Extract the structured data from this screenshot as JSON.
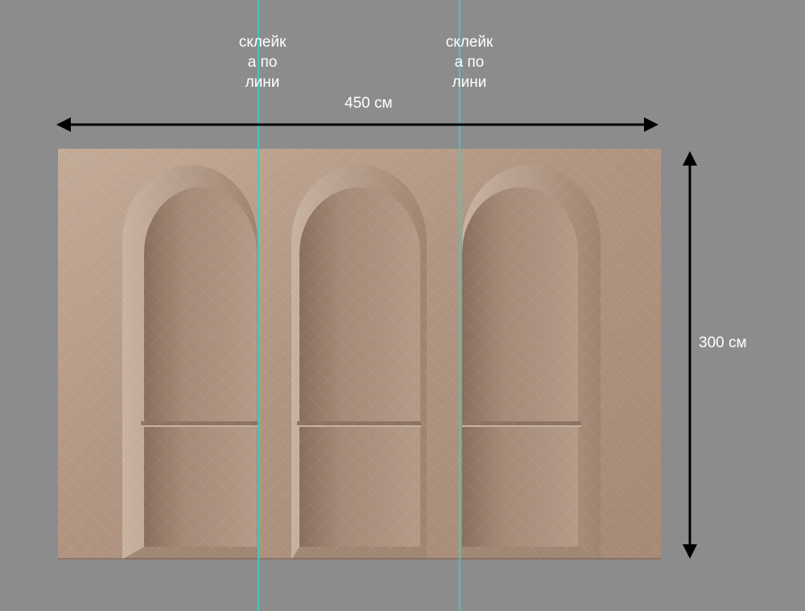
{
  "width_label": "450 см",
  "height_label": "300 см",
  "seam_label": "склейк\nа по\nлини",
  "colors": {
    "background": "#8c8c8c",
    "wall": "#b49a86",
    "wall_shadow": "#8e7463",
    "seam_line": "#2fd3d0",
    "arrow": "#000000",
    "text": "#ffffff"
  },
  "arches": [
    {
      "name": "arch-left"
    },
    {
      "name": "arch-middle"
    },
    {
      "name": "arch-right"
    }
  ]
}
